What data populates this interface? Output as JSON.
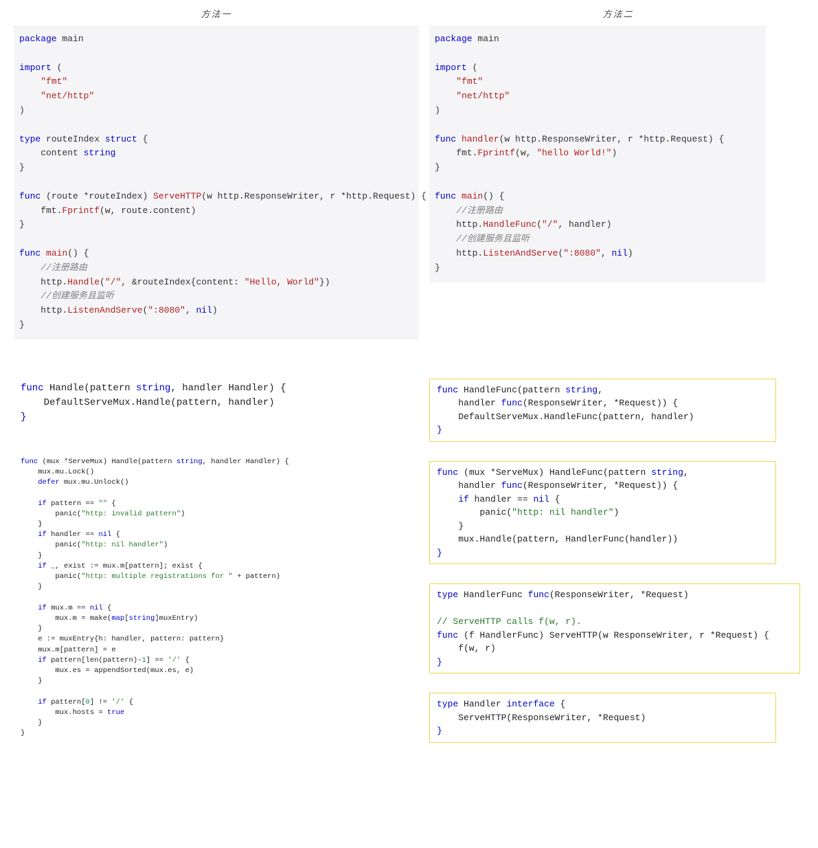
{
  "headings": {
    "left": "方法一",
    "right": "方法二"
  },
  "left_gray_code": {
    "tokens": [
      {
        "t": "package ",
        "c": "kw"
      },
      {
        "t": "main",
        "c": ""
      },
      {
        "t": "\n\n"
      },
      {
        "t": "import ",
        "c": "kw"
      },
      {
        "t": "("
      },
      {
        "t": "\n    "
      },
      {
        "t": "\"fmt\"",
        "c": "str"
      },
      {
        "t": "\n    "
      },
      {
        "t": "\"net/http\"",
        "c": "str"
      },
      {
        "t": "\n)"
      },
      {
        "t": "\n\n"
      },
      {
        "t": "type ",
        "c": "kw"
      },
      {
        "t": "routeIndex ",
        "c": ""
      },
      {
        "t": "struct ",
        "c": "kw"
      },
      {
        "t": "{"
      },
      {
        "t": "\n    content ",
        "c": ""
      },
      {
        "t": "string",
        "c": "kw"
      },
      {
        "t": "\n}"
      },
      {
        "t": "\n\n"
      },
      {
        "t": "func ",
        "c": "kw"
      },
      {
        "t": "(route *routeIndex) ",
        "c": ""
      },
      {
        "t": "ServeHTTP",
        "c": "fn"
      },
      {
        "t": "(w http.ResponseWriter, r *http.Request) {"
      },
      {
        "t": "\n    fmt."
      },
      {
        "t": "Fprintf",
        "c": "fn"
      },
      {
        "t": "(w, route.content)"
      },
      {
        "t": "\n}"
      },
      {
        "t": "\n\n"
      },
      {
        "t": "func ",
        "c": "kw"
      },
      {
        "t": "main",
        "c": "fn"
      },
      {
        "t": "() {"
      },
      {
        "t": "\n    "
      },
      {
        "t": "//注册路由",
        "c": "cmt"
      },
      {
        "t": "\n    http."
      },
      {
        "t": "Handle",
        "c": "fn"
      },
      {
        "t": "("
      },
      {
        "t": "\"/\"",
        "c": "str"
      },
      {
        "t": ", &routeIndex{content: "
      },
      {
        "t": "\"Hello, World\"",
        "c": "str"
      },
      {
        "t": "})"
      },
      {
        "t": "\n    "
      },
      {
        "t": "//创建服务且监听",
        "c": "cmt"
      },
      {
        "t": "\n    http."
      },
      {
        "t": "ListenAndServe",
        "c": "fn"
      },
      {
        "t": "("
      },
      {
        "t": "\":8080\"",
        "c": "str"
      },
      {
        "t": ", "
      },
      {
        "t": "nil",
        "c": "kw"
      },
      {
        "t": ")"
      },
      {
        "t": "\n}"
      }
    ]
  },
  "right_gray_code": {
    "tokens": [
      {
        "t": "package ",
        "c": "kw"
      },
      {
        "t": "main",
        "c": ""
      },
      {
        "t": "\n\n"
      },
      {
        "t": "import ",
        "c": "kw"
      },
      {
        "t": "("
      },
      {
        "t": "\n    "
      },
      {
        "t": "\"fmt\"",
        "c": "str"
      },
      {
        "t": "\n    "
      },
      {
        "t": "\"net/http\"",
        "c": "str"
      },
      {
        "t": "\n)"
      },
      {
        "t": "\n\n"
      },
      {
        "t": "func ",
        "c": "kw"
      },
      {
        "t": "handler",
        "c": "fn"
      },
      {
        "t": "(w http.ResponseWriter, r *http.Request) {"
      },
      {
        "t": "\n    fmt."
      },
      {
        "t": "Fprintf",
        "c": "fn"
      },
      {
        "t": "(w, "
      },
      {
        "t": "\"hello World!\"",
        "c": "str"
      },
      {
        "t": ")"
      },
      {
        "t": "\n}"
      },
      {
        "t": "\n\n"
      },
      {
        "t": "func ",
        "c": "kw"
      },
      {
        "t": "main",
        "c": "fn"
      },
      {
        "t": "() {"
      },
      {
        "t": "\n    "
      },
      {
        "t": "//注册路由",
        "c": "cmt"
      },
      {
        "t": "\n    http."
      },
      {
        "t": "HandleFunc",
        "c": "fn"
      },
      {
        "t": "("
      },
      {
        "t": "\"/\"",
        "c": "str"
      },
      {
        "t": ", handler)"
      },
      {
        "t": "\n    "
      },
      {
        "t": "//创建服务且监听",
        "c": "cmt"
      },
      {
        "t": "\n    http."
      },
      {
        "t": "ListenAndServe",
        "c": "fn"
      },
      {
        "t": "("
      },
      {
        "t": "\":8080\"",
        "c": "str"
      },
      {
        "t": ", "
      },
      {
        "t": "nil",
        "c": "kw"
      },
      {
        "t": ")"
      },
      {
        "t": "\n}"
      }
    ]
  },
  "left_snippet_handle": {
    "tokens": [
      {
        "t": "func ",
        "c": "kw"
      },
      {
        "t": "Handle(pattern "
      },
      {
        "t": "string",
        "c": "kw"
      },
      {
        "t": ", handler Handler) {"
      },
      {
        "t": "\n    DefaultServeMux.Handle(pattern, handler)"
      },
      {
        "t": "\n"
      },
      {
        "t": "}",
        "c": "kw"
      }
    ]
  },
  "left_snippet_mux": {
    "tokens": [
      {
        "t": "func ",
        "c": "kw"
      },
      {
        "t": "(mux *ServeMux) Handle(pattern "
      },
      {
        "t": "string",
        "c": "kw"
      },
      {
        "t": ", handler Handler) {"
      },
      {
        "t": "\n    mux.mu.Lock()"
      },
      {
        "t": "\n    "
      },
      {
        "t": "defer ",
        "c": "kw"
      },
      {
        "t": "mux.mu.Unlock()"
      },
      {
        "t": "\n\n    "
      },
      {
        "t": "if ",
        "c": "kw"
      },
      {
        "t": "pattern == "
      },
      {
        "t": "\"\"",
        "c": "strg"
      },
      {
        "t": " {"
      },
      {
        "t": "\n        panic("
      },
      {
        "t": "\"http: invalid pattern\"",
        "c": "strg"
      },
      {
        "t": ")"
      },
      {
        "t": "\n    }"
      },
      {
        "t": "\n    "
      },
      {
        "t": "if ",
        "c": "kw"
      },
      {
        "t": "handler == "
      },
      {
        "t": "nil",
        "c": "kw"
      },
      {
        "t": " {"
      },
      {
        "t": "\n        panic("
      },
      {
        "t": "\"http: nil handler\"",
        "c": "strg"
      },
      {
        "t": ")"
      },
      {
        "t": "\n    }"
      },
      {
        "t": "\n    "
      },
      {
        "t": "if ",
        "c": "kw"
      },
      {
        "t": "_, exist := mux.m[pattern]; exist {"
      },
      {
        "t": "\n        panic("
      },
      {
        "t": "\"http: multiple registrations for \"",
        "c": "strg"
      },
      {
        "t": " + pattern)"
      },
      {
        "t": "\n    }"
      },
      {
        "t": "\n\n    "
      },
      {
        "t": "if ",
        "c": "kw"
      },
      {
        "t": "mux.m == "
      },
      {
        "t": "nil",
        "c": "kw"
      },
      {
        "t": " {"
      },
      {
        "t": "\n        mux.m = make("
      },
      {
        "t": "map",
        "c": "kw"
      },
      {
        "t": "["
      },
      {
        "t": "string",
        "c": "kw"
      },
      {
        "t": "]muxEntry)"
      },
      {
        "t": "\n    }"
      },
      {
        "t": "\n    e := muxEntry{h: handler, pattern: pattern}"
      },
      {
        "t": "\n    mux.m[pattern] = e"
      },
      {
        "t": "\n    "
      },
      {
        "t": "if ",
        "c": "kw"
      },
      {
        "t": "pattern[len(pattern)-"
      },
      {
        "t": "1",
        "c": "num"
      },
      {
        "t": "] == "
      },
      {
        "t": "'/'",
        "c": "strg"
      },
      {
        "t": " {"
      },
      {
        "t": "\n        mux.es = appendSorted(mux.es, e)"
      },
      {
        "t": "\n    }"
      },
      {
        "t": "\n\n    "
      },
      {
        "t": "if ",
        "c": "kw"
      },
      {
        "t": "pattern["
      },
      {
        "t": "0",
        "c": "num"
      },
      {
        "t": "] != "
      },
      {
        "t": "'/'",
        "c": "strg"
      },
      {
        "t": " {"
      },
      {
        "t": "\n        mux.hosts = "
      },
      {
        "t": "true",
        "c": "true"
      },
      {
        "t": "\n    }"
      },
      {
        "t": "\n}"
      }
    ]
  },
  "right_box1": {
    "tokens": [
      {
        "t": "func ",
        "c": "kw"
      },
      {
        "t": "HandleFunc(pattern "
      },
      {
        "t": "string",
        "c": "kw"
      },
      {
        "t": ","
      },
      {
        "t": "\n    handler "
      },
      {
        "t": "func",
        "c": "kw"
      },
      {
        "t": "(ResponseWriter, *Request)) {"
      },
      {
        "t": "\n    DefaultServeMux.HandleFunc(pattern, handler)"
      },
      {
        "t": "\n"
      },
      {
        "t": "}",
        "c": "kw"
      }
    ]
  },
  "right_box2": {
    "tokens": [
      {
        "t": "func ",
        "c": "kw"
      },
      {
        "t": "(mux *ServeMux) HandleFunc(pattern "
      },
      {
        "t": "string",
        "c": "kw"
      },
      {
        "t": ","
      },
      {
        "t": "\n    handler "
      },
      {
        "t": "func",
        "c": "kw"
      },
      {
        "t": "(ResponseWriter, *Request)) {"
      },
      {
        "t": "\n    "
      },
      {
        "t": "if ",
        "c": "kw"
      },
      {
        "t": "handler == "
      },
      {
        "t": "nil",
        "c": "kw"
      },
      {
        "t": " {"
      },
      {
        "t": "\n        panic("
      },
      {
        "t": "\"http: nil handler\"",
        "c": "strg"
      },
      {
        "t": ")"
      },
      {
        "t": "\n    }"
      },
      {
        "t": "\n    mux.Handle(pattern, HandlerFunc(handler))"
      },
      {
        "t": "\n"
      },
      {
        "t": "}",
        "c": "kw"
      }
    ]
  },
  "right_box3": {
    "tokens": [
      {
        "t": "type ",
        "c": "kw"
      },
      {
        "t": "HandlerFunc "
      },
      {
        "t": "func",
        "c": "kw"
      },
      {
        "t": "(ResponseWriter, *Request)"
      },
      {
        "t": "\n\n"
      },
      {
        "t": "// ServeHTTP calls f(w, r).",
        "c": "cmtg"
      },
      {
        "t": "\n"
      },
      {
        "t": "func ",
        "c": "kw"
      },
      {
        "t": "(f HandlerFunc) ServeHTTP(w ResponseWriter, r *Request) {"
      },
      {
        "t": "\n    f(w, r)"
      },
      {
        "t": "\n"
      },
      {
        "t": "}",
        "c": "kw"
      }
    ]
  },
  "right_box4": {
    "tokens": [
      {
        "t": "type ",
        "c": "kw"
      },
      {
        "t": "Handler "
      },
      {
        "t": "interface ",
        "c": "kw"
      },
      {
        "t": "{"
      },
      {
        "t": "\n    ServeHTTP(ResponseWriter, *Request)"
      },
      {
        "t": "\n"
      },
      {
        "t": "}",
        "c": "kw"
      }
    ]
  }
}
